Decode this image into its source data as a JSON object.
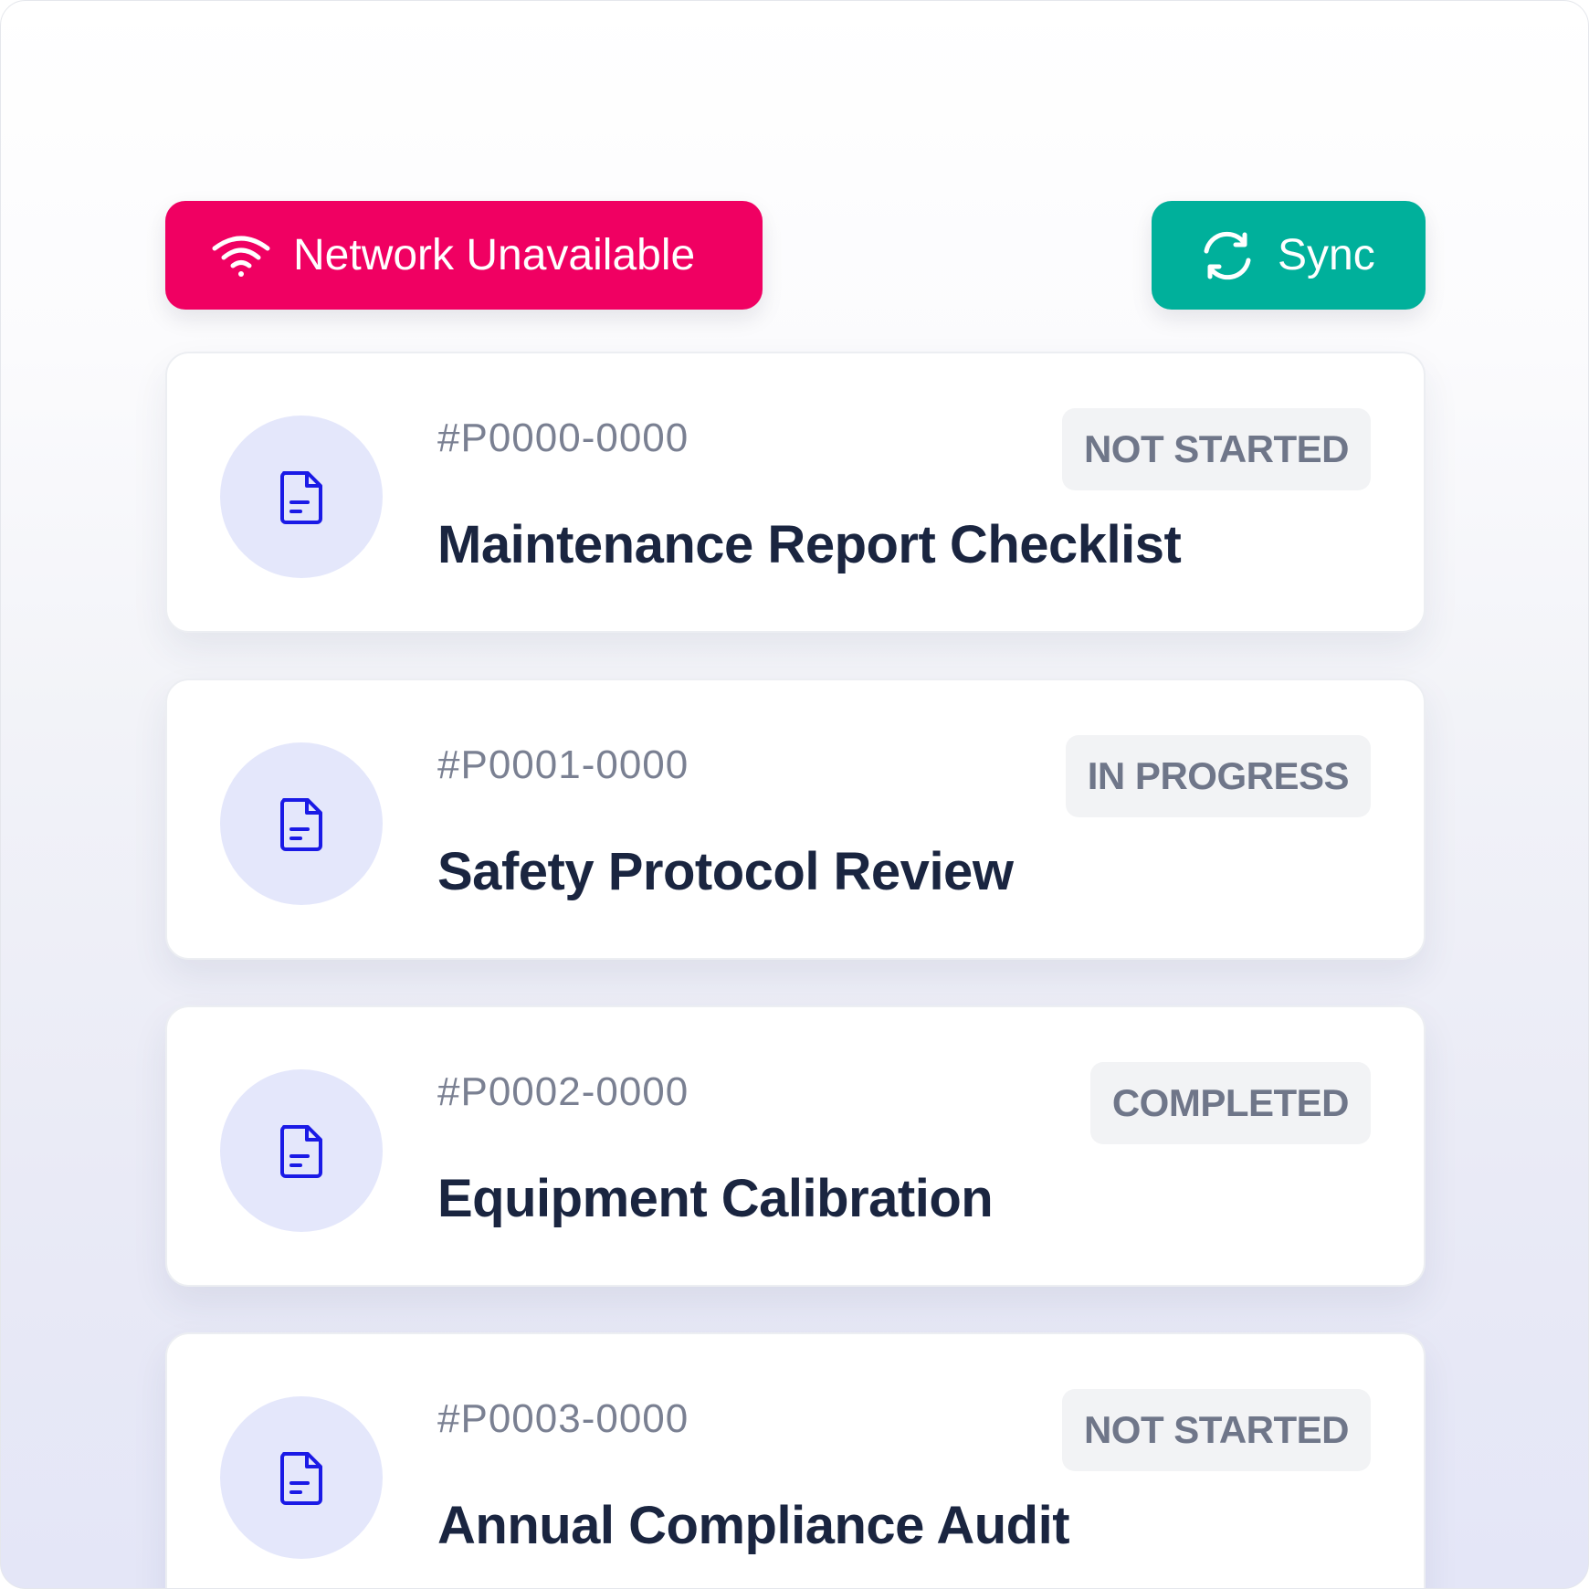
{
  "status_bar": {
    "network_label": "Network Unavailable",
    "network_icon": "wifi-icon",
    "network_color": "#f00062",
    "sync_label": "Sync",
    "sync_icon": "sync-icon",
    "sync_color": "#00b09b"
  },
  "items": [
    {
      "id": "#P0000-0000",
      "title": "Maintenance Report Checklist",
      "status": "NOT STARTED",
      "icon": "document-icon"
    },
    {
      "id": "#P0001-0000",
      "title": "Safety Protocol Review",
      "status": "IN PROGRESS",
      "icon": "document-icon"
    },
    {
      "id": "#P0002-0000",
      "title": "Equipment Calibration",
      "status": "COMPLETED",
      "icon": "document-icon"
    },
    {
      "id": "#P0003-0000",
      "title": "Annual Compliance Audit",
      "status": "NOT STARTED",
      "icon": "document-icon"
    }
  ],
  "colors": {
    "icon_accent": "#1a1ae6",
    "avatar_bg": "#e4e7fb",
    "title_text": "#1a2540",
    "muted_text": "#7a8092",
    "badge_bg": "#f2f3f5"
  }
}
